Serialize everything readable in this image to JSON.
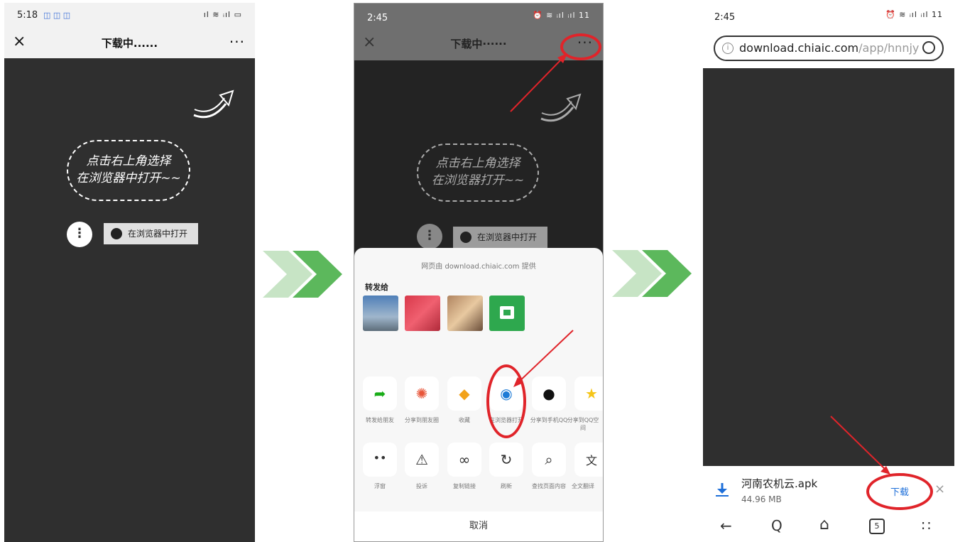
{
  "colors": {
    "accent_red": "#e0242a",
    "chevron_green": "#5cb85c",
    "chevron_light": "#c7e4c5",
    "sheet_bg": "#f7f7f7"
  },
  "panel1": {
    "status_time": "5:18",
    "status_icons": "◫ ◫ ◫",
    "status_right": "ıl ≋ ᵢıl ▭",
    "nav_close": "×",
    "nav_title": "下载中......",
    "nav_more": "···",
    "hint_line1": "点击右上角选择",
    "hint_line2": "在浏览器中打开~~",
    "dots": "⋮",
    "open_label": "在浏览器中打开"
  },
  "panel2": {
    "status_time": "2:45",
    "status_right": "⏰ ≋ ᵢıl ᵢıl 11",
    "nav_close": "×",
    "nav_title": "下载中······",
    "nav_more": "···",
    "hint_line1": "点击右上角选择",
    "hint_line2": "在浏览器打开~~",
    "open_label": "在浏览器中打开",
    "provider": "网页由 download.chiaic.com 提供",
    "forward_to": "转发给",
    "row1": [
      {
        "icon": "share-arrow-icon",
        "glyph": "➦",
        "label": "转发给朋友"
      },
      {
        "icon": "moments-icon",
        "glyph": "✺",
        "label": "分享到朋友圈"
      },
      {
        "icon": "favorite-icon",
        "glyph": "◆",
        "label": "收藏"
      },
      {
        "icon": "browser-icon",
        "glyph": "◉",
        "label": "在浏览器打开"
      },
      {
        "icon": "qq-icon",
        "glyph": "●",
        "label": "分享到手机QQ"
      },
      {
        "icon": "qzone-icon",
        "glyph": "★",
        "label": "分享到QQ空间"
      }
    ],
    "row2": [
      {
        "icon": "float-window-icon",
        "glyph": "••",
        "label": "浮窗"
      },
      {
        "icon": "complaint-icon",
        "glyph": "⚠",
        "label": "投诉"
      },
      {
        "icon": "copy-link-icon",
        "glyph": "∞",
        "label": "复制链接"
      },
      {
        "icon": "refresh-icon",
        "glyph": "↻",
        "label": "刷新"
      },
      {
        "icon": "find-in-page-icon",
        "glyph": "⌕",
        "label": "查找页面内容"
      },
      {
        "icon": "translate-icon",
        "glyph": "文",
        "label": "全文翻译"
      }
    ],
    "cancel": "取消"
  },
  "panel3": {
    "status_time": "2:45",
    "status_right": "⏰ ≋ ᵢıl ᵢıl 11",
    "url_host": "download.chiaic.com",
    "url_path": "/app/hnnjy",
    "file_name": "河南农机云.apk",
    "file_size": "44.96 MB",
    "download_label": "下载",
    "dismiss": "×",
    "tab_count": "5",
    "nav_back": "←",
    "nav_search": "Q",
    "nav_home": "⌂",
    "nav_menu": "∷"
  }
}
